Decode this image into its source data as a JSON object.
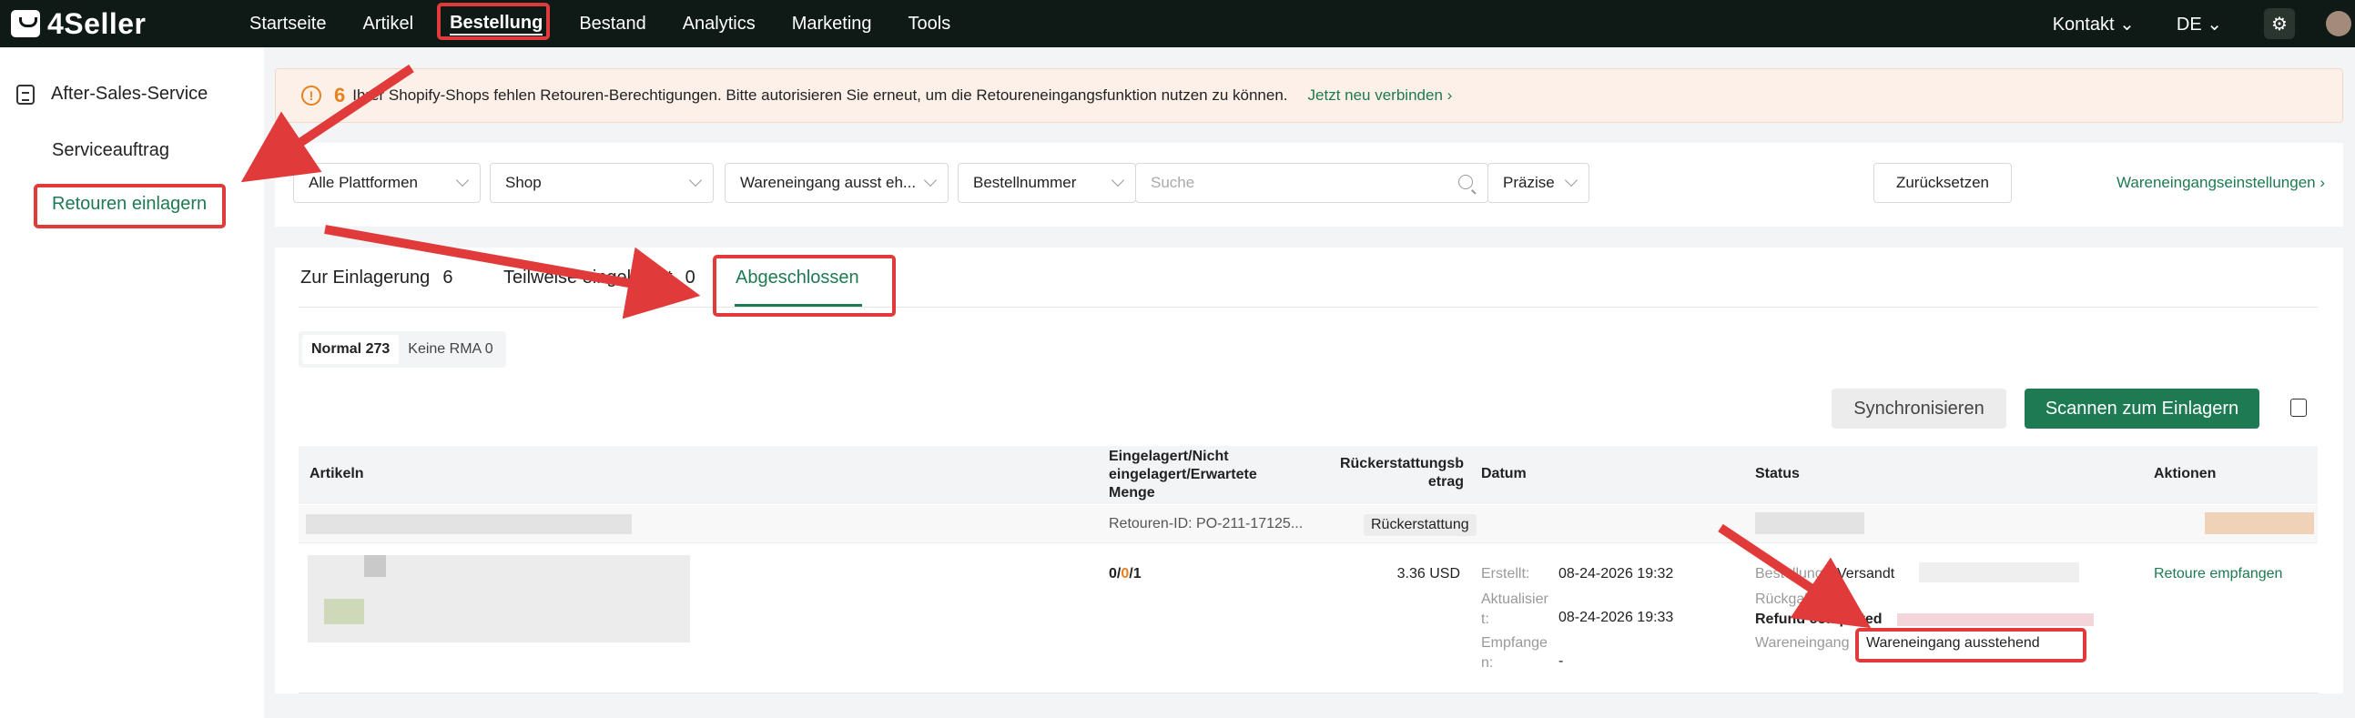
{
  "header": {
    "logo_text": "4Seller",
    "nav": [
      "Startseite",
      "Artikel",
      "Bestellung",
      "Bestand",
      "Analytics",
      "Marketing",
      "Tools"
    ],
    "active_nav": "Bestellung",
    "contact": "Kontakt",
    "language": "DE"
  },
  "sidebar": {
    "section": "After-Sales-Service",
    "items": [
      "Serviceauftrag",
      "Retouren einlagern"
    ],
    "active": "Retouren einlagern"
  },
  "banner": {
    "count": "6",
    "message": "Ihrer Shopify-Shops fehlen Retouren-Berechtigungen. Bitte autorisieren Sie erneut, um die Retoureneingangsfunktion nutzen zu können.",
    "link": "Jetzt neu verbinden ›"
  },
  "filters": {
    "platform": "Alle Plattformen",
    "shop": "Shop",
    "receipt_status": "Wareneingang ausst eh...",
    "order_field": "Bestellnummer",
    "search_placeholder": "Suche",
    "match_mode": "Präzise",
    "reset": "Zurücksetzen",
    "settings_link": "Wareneingangseinstellungen ›"
  },
  "tabs": {
    "t1_label": "Zur Einlagerung",
    "t1_count": "6",
    "t2_label": "Teilweise eingelagert",
    "t2_count": "0",
    "t3_label": "Abgeschlossen"
  },
  "segments": {
    "normal": "Normal 273",
    "no_rma": "Keine RMA 0"
  },
  "actions": {
    "sync": "Synchronisieren",
    "scan": "Scannen zum Einlagern"
  },
  "table": {
    "headers": {
      "items": "Artikeln",
      "qty_line1": "Eingelagert/Nicht",
      "qty_line2": "eingelagert/Erwartete",
      "qty_line3": "Menge",
      "refund_line1": "Rückerstattungsb",
      "refund_line2": "etrag",
      "date": "Datum",
      "status": "Status",
      "actions": "Aktionen"
    },
    "group": {
      "return_id": "Retouren-ID: PO-211-17125...",
      "type_chip": "Rückerstattung"
    },
    "row": {
      "qty_a": "0/",
      "qty_b": "0",
      "qty_c": "/1",
      "amount": "3.36 USD",
      "created_label": "Erstellt:",
      "created_value": "08-24-2026 19:32",
      "updated_label_1": "Aktualisier",
      "updated_label_2": "t:",
      "updated_value": "08-24-2026 19:33",
      "received_label_1": "Empfange",
      "received_label_2": "n:",
      "received_value": "-",
      "status_order_label": "Bestellung",
      "status_order_value": "Versandt",
      "status_return_label": "Rückgabe",
      "status_refund_value": "Refund completed",
      "status_receipt_label": "Wareneingang",
      "status_receipt_value": "Wareneingang ausstehend",
      "action": "Retoure empfangen"
    }
  }
}
